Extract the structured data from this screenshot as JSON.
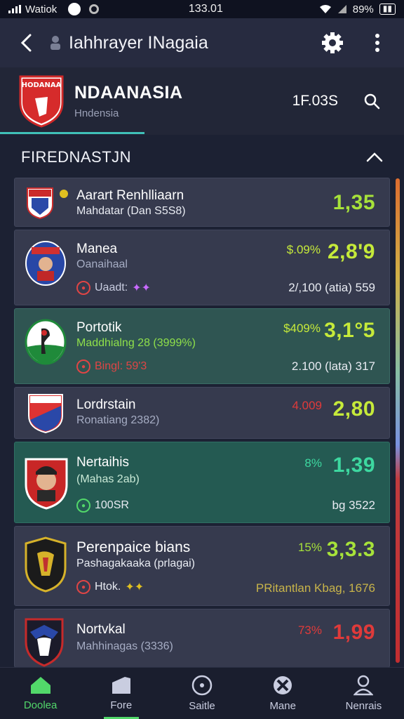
{
  "status": {
    "carrier": "Watiok",
    "time": "133.01",
    "battery_pct": "89%"
  },
  "app_bar": {
    "title": "Iahhrayer INagaia"
  },
  "team": {
    "name": "NDAANASIA",
    "subtitle": "Hndensia",
    "value": "1F.03S",
    "crest_text": "HODANAA"
  },
  "section": {
    "title": "FIREDNASTJN"
  },
  "rows": [
    {
      "name": "Aarart Renhlliaarn",
      "sub": "Mahdatar (Dan S5S8)",
      "odds": "1,35"
    },
    {
      "name": "Manea",
      "sub": "Oanaihaal",
      "meta": "Uaadt:",
      "pct": "$.09%",
      "odds": "2,8'9",
      "stat": "2/,100  (atia)  559"
    },
    {
      "name": "Portotik",
      "sub": "Maddhialng 28 (3999%)",
      "meta": "Bingl:  59'3",
      "pct": "$409%",
      "odds": "3,1°5",
      "stat": "2.100  (lata)  317"
    },
    {
      "name": "Lordrstain",
      "sub": "Ronatiang 2382)",
      "pct": "4.009",
      "odds": "2,80"
    },
    {
      "name": "Nertaihis",
      "sub": "(Mahas 2ab)",
      "meta": "100SR",
      "pct": "8%",
      "odds": "1,39",
      "stat": "bg 3522"
    },
    {
      "name": "Perenpaice bians",
      "sub": "Pashagakaaka (prlagai)",
      "meta": "Htok.",
      "pct": "15%",
      "odds": "3,3.3",
      "stat": "PRitantlan Kbag,  1676"
    },
    {
      "name": "Nortvkal",
      "sub": "Mahhinagas (3336)",
      "pct": "73%",
      "odds": "1,99"
    }
  ],
  "nav": [
    {
      "label": "Doolea"
    },
    {
      "label": "Fore"
    },
    {
      "label": "Saitle"
    },
    {
      "label": "Mane"
    },
    {
      "label": "Nenrais"
    }
  ],
  "colors": {
    "accent": "#52d86a",
    "odds_green": "#a7e23a",
    "odds_red": "#e03a3a",
    "odds_teal": "#3dd8a0"
  }
}
